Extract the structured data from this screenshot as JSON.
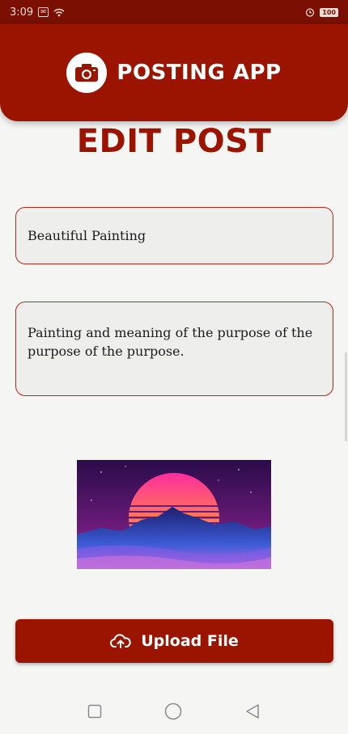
{
  "status_bar": {
    "time": "3:09",
    "battery": "100"
  },
  "app_bar": {
    "title": "POSTING APP",
    "logo_icon": "camera-icon"
  },
  "page": {
    "title": "EDIT POST"
  },
  "form": {
    "title_value": "Beautiful Painting",
    "description_value": "Painting and meaning of the purpose of the purpose of the purpose."
  },
  "upload": {
    "label": "Upload File",
    "icon": "cloud-upload-icon"
  },
  "nav": {
    "icons": [
      "square-icon",
      "circle-home-icon",
      "triangle-back-icon"
    ]
  },
  "colors": {
    "primary": "#9b1400",
    "status_bar": "#7a0f02",
    "background": "#f5f6f4",
    "field_border": "#b5271a"
  }
}
